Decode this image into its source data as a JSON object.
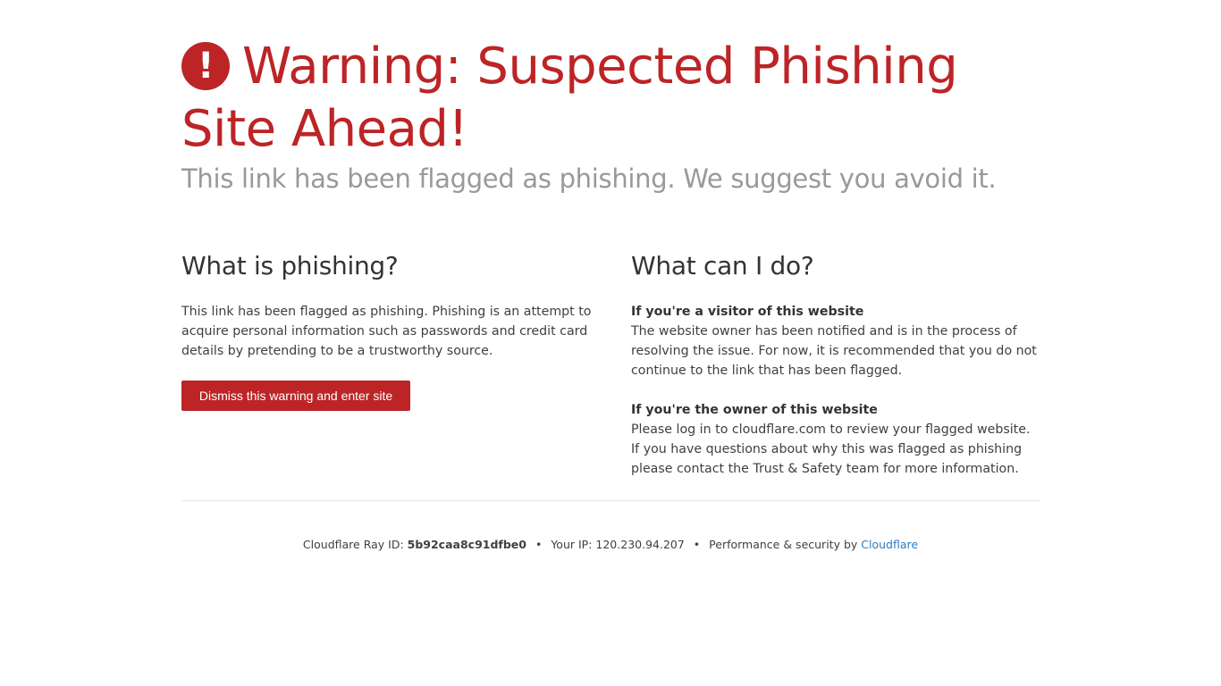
{
  "header": {
    "icon": "exclamation-circle-icon",
    "icon_glyph": "!",
    "title": "Warning: Suspected Phishing Site Ahead!",
    "subtitle": "This link has been flagged as phishing. We suggest you avoid it."
  },
  "left": {
    "heading": "What is phishing?",
    "body": "This link has been flagged as phishing. Phishing is an attempt to acquire personal information such as passwords and credit card details by pretending to be a trustworthy source.",
    "button_label": "Dismiss this warning and enter site"
  },
  "right": {
    "heading": "What can I do?",
    "visitor_title": "If you're a visitor of this website",
    "visitor_body": "The website owner has been notified and is in the process of resolving the issue. For now, it is recommended that you do not continue to the link that has been flagged.",
    "owner_title": "If you're the owner of this website",
    "owner_body": "Please log in to cloudflare.com to review your flagged website. If you have questions about why this was flagged as phishing please contact the Trust & Safety team for more information."
  },
  "footer": {
    "ray_label": "Cloudflare Ray ID:",
    "ray_id": "5b92caa8c91dfbe0",
    "separator": "•",
    "ip_label": "Your IP:",
    "ip": "120.230.94.207",
    "perf_label": "Performance & security by",
    "cloudflare_link": "Cloudflare"
  },
  "colors": {
    "accent": "#bd2426",
    "subtitle": "#999999",
    "link": "#2f7bbf",
    "divider": "#e6e6e6"
  }
}
